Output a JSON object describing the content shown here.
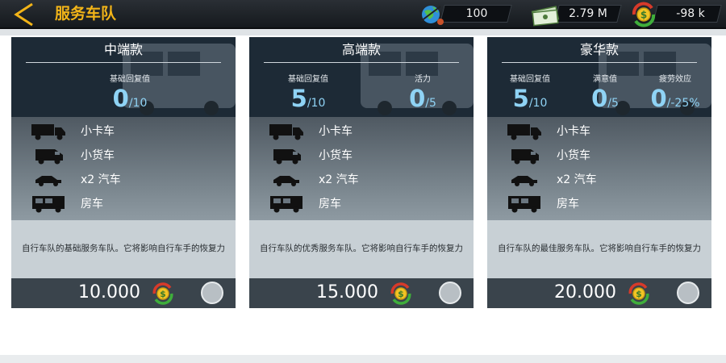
{
  "header": {
    "back_icon": "back-chevron-icon",
    "title": "服务车队",
    "stats": [
      {
        "name": "globe-stat",
        "icon": "globe-icon",
        "value": "100"
      },
      {
        "name": "cash-stat",
        "icon": "cash-stack-icon",
        "value": "2.79 M"
      },
      {
        "name": "coin-stat",
        "icon": "dollar-coin-icon",
        "value": "-98 k"
      }
    ]
  },
  "cards": [
    {
      "title": "中端款",
      "metrics": [
        {
          "label": "基础回复值",
          "value": "0",
          "max": "/10"
        }
      ],
      "vehicles": [
        {
          "icon": "truck-icon",
          "label": "小卡车"
        },
        {
          "icon": "van-icon",
          "label": "小货车"
        },
        {
          "icon": "car-icon",
          "label": "x2 汽车"
        },
        {
          "icon": "camper-icon",
          "label": "房车"
        }
      ],
      "description": "自行车队的基础服务车队。它将影响自行车手的恢复力",
      "price": "10.000"
    },
    {
      "title": "高端款",
      "metrics": [
        {
          "label": "基础回复值",
          "value": "5",
          "max": "/10"
        },
        {
          "label": "活力",
          "value": "0",
          "max": "/5"
        }
      ],
      "vehicles": [
        {
          "icon": "truck-icon",
          "label": "小卡车"
        },
        {
          "icon": "van-icon",
          "label": "小货车"
        },
        {
          "icon": "car-icon",
          "label": "x2 汽车"
        },
        {
          "icon": "camper-icon",
          "label": "房车"
        }
      ],
      "description": "自行车队的优秀服务车队。它将影响自行车手的恢复力",
      "price": "15.000"
    },
    {
      "title": "豪华款",
      "metrics": [
        {
          "label": "基础回复值",
          "value": "5",
          "max": "/10"
        },
        {
          "label": "满意值",
          "value": "0",
          "max": "/5"
        },
        {
          "label": "疲劳效应",
          "value": "0",
          "max": "/-25%"
        }
      ],
      "vehicles": [
        {
          "icon": "truck-icon",
          "label": "小卡车"
        },
        {
          "icon": "van-icon",
          "label": "小货车"
        },
        {
          "icon": "car-icon",
          "label": "x2 汽车"
        },
        {
          "icon": "camper-icon",
          "label": "房车"
        }
      ],
      "description": "自行车队的最佳服务车队。它将影响自行车手的恢复力",
      "price": "20.000"
    }
  ],
  "colors": {
    "accent": "#f2b418",
    "metric": "#8fd3f5",
    "card_head": "#1d2a36",
    "footer": "#3a444c"
  }
}
